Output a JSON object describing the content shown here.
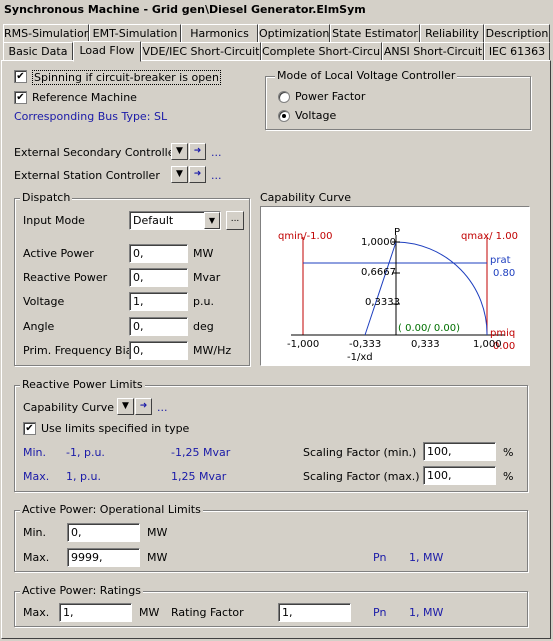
{
  "window": {
    "title": "Synchronous Machine - Grid gen\\Diesel Generator.ElmSym"
  },
  "tabs_row1": [
    "RMS-Simulation",
    "EMT-Simulation",
    "Harmonics",
    "Optimization",
    "State Estimator",
    "Reliability",
    "Description"
  ],
  "tabs_row2": [
    "Basic Data",
    "Load Flow",
    "VDE/IEC Short-Circuit",
    "Complete Short-Circuit",
    "ANSI Short-Circuit",
    "IEC 61363"
  ],
  "active_tab": "Load Flow",
  "options": {
    "spinning_label": "Spinning if circuit-breaker is open",
    "spinning_checked": "✔",
    "reference_label": "Reference Machine",
    "reference_checked": "✔",
    "bus_type_label": "Corresponding Bus Type:",
    "bus_type_value": "SL"
  },
  "voltage_controller": {
    "title": "Mode of Local Voltage Controller",
    "option1": "Power Factor",
    "option2": "Voltage",
    "selected": "Voltage"
  },
  "controllers": {
    "secondary_label": "External Secondary Controller",
    "station_label": "External Station Controller",
    "ellipsis": "..."
  },
  "dispatch": {
    "title": "Dispatch",
    "input_mode_label": "Input Mode",
    "input_mode_value": "Default",
    "more": "...",
    "rows": [
      {
        "label": "Active Power",
        "value": "0,",
        "unit": "MW"
      },
      {
        "label": "Reactive Power",
        "value": "0,",
        "unit": "Mvar"
      },
      {
        "label": "Voltage",
        "value": "1,",
        "unit": "p.u."
      },
      {
        "label": "Angle",
        "value": "0,",
        "unit": "deg"
      },
      {
        "label": "Prim. Frequency Bias",
        "value": "0,",
        "unit": "MW/Hz"
      }
    ]
  },
  "capability_curve": {
    "title": "Capability Curve",
    "qmin": "qmin/-1.00",
    "qmax": "qmax/ 1.00",
    "p_label": "P",
    "y1": "1,0000",
    "y2": "0,6667",
    "y3": "0,3333",
    "prat": "prat",
    "prat_value": "0.80",
    "point": "( 0.00/ 0.00)",
    "pmiq": "pmiq",
    "pmiq_value": "0.00",
    "x_ticks": [
      "-1,000",
      "-0,333",
      "0,333",
      "1,000"
    ],
    "xd_label": "-1/xd"
  },
  "reactive_limits": {
    "title": "Reactive Power Limits",
    "curve_label": "Capability Curve",
    "ellipsis": "...",
    "use_limits_label": "Use limits specified in type",
    "use_limits_checked": "✔",
    "min_label": "Min.",
    "min_pu": "-1, p.u.",
    "min_mvar": "-1,25 Mvar",
    "max_label": "Max.",
    "max_pu": "1, p.u.",
    "max_mvar": "1,25 Mvar",
    "scale_min_label": "Scaling Factor (min.)",
    "scale_min_value": "100,",
    "scale_max_label": "Scaling Factor (max.)",
    "scale_max_value": "100,",
    "percent": "%"
  },
  "op_limits": {
    "title": "Active Power: Operational Limits",
    "min_label": "Min.",
    "min_value": "0,",
    "max_label": "Max.",
    "max_value": "9999,",
    "unit": "MW",
    "pn_label": "Pn",
    "pn_value": "1, MW"
  },
  "ratings": {
    "title": "Active Power: Ratings",
    "max_label": "Max.",
    "max_value": "1,",
    "unit": "MW",
    "rating_label": "Rating Factor",
    "rating_value": "1,",
    "pn_label": "Pn",
    "pn_value": "1, MW"
  },
  "colors": {
    "accent_blue": "#1a1aa8",
    "curve_red": "#c00000",
    "curve_blue": "#1e3fbf"
  }
}
